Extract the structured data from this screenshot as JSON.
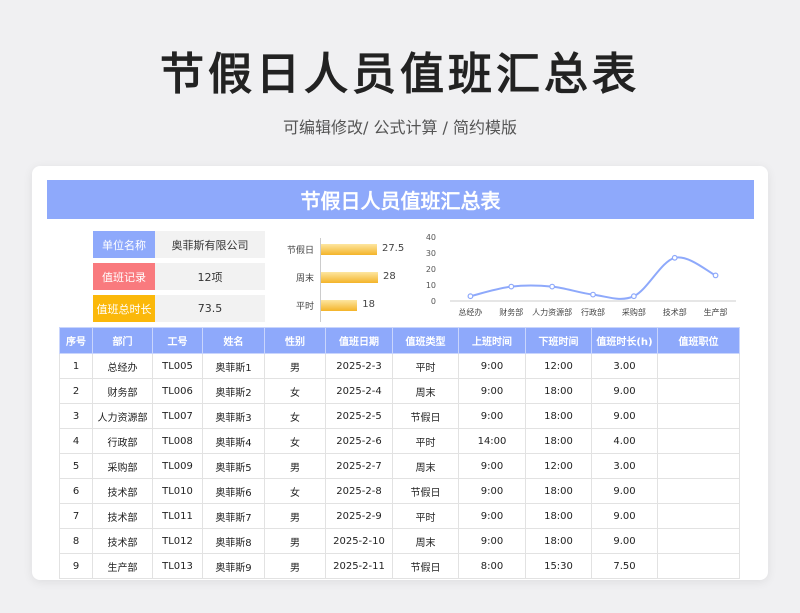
{
  "page": {
    "title": "节假日人员值班汇总表",
    "subtitle": "可编辑修改/  公式计算  /  简约模版"
  },
  "sheet": {
    "banner": "节假日人员值班汇总表",
    "info": [
      {
        "label": "单位名称",
        "value": "奥菲斯有限公司",
        "color": "#8ea9fb"
      },
      {
        "label": "值班记录",
        "value": "12项",
        "color": "#f97a7e"
      },
      {
        "label": "值班总时长",
        "value": "73.5",
        "color": "#fbb80a"
      }
    ],
    "columns": [
      "序号",
      "部门",
      "工号",
      "姓名",
      "性别",
      "值班日期",
      "值班类型",
      "上班时间",
      "下班时间",
      "值班时长(h)",
      "值班职位"
    ],
    "rows": [
      [
        "1",
        "总经办",
        "TL005",
        "奥菲斯1",
        "男",
        "2025-2-3",
        "平时",
        "9:00",
        "12:00",
        "3.00",
        ""
      ],
      [
        "2",
        "财务部",
        "TL006",
        "奥菲斯2",
        "女",
        "2025-2-4",
        "周末",
        "9:00",
        "18:00",
        "9.00",
        ""
      ],
      [
        "3",
        "人力资源部",
        "TL007",
        "奥菲斯3",
        "女",
        "2025-2-5",
        "节假日",
        "9:00",
        "18:00",
        "9.00",
        ""
      ],
      [
        "4",
        "行政部",
        "TL008",
        "奥菲斯4",
        "女",
        "2025-2-6",
        "平时",
        "14:00",
        "18:00",
        "4.00",
        ""
      ],
      [
        "5",
        "采购部",
        "TL009",
        "奥菲斯5",
        "男",
        "2025-2-7",
        "周末",
        "9:00",
        "12:00",
        "3.00",
        ""
      ],
      [
        "6",
        "技术部",
        "TL010",
        "奥菲斯6",
        "女",
        "2025-2-8",
        "节假日",
        "9:00",
        "18:00",
        "9.00",
        ""
      ],
      [
        "7",
        "技术部",
        "TL011",
        "奥菲斯7",
        "男",
        "2025-2-9",
        "平时",
        "9:00",
        "18:00",
        "9.00",
        ""
      ],
      [
        "8",
        "技术部",
        "TL012",
        "奥菲斯8",
        "男",
        "2025-2-10",
        "周末",
        "9:00",
        "18:00",
        "9.00",
        ""
      ],
      [
        "9",
        "生产部",
        "TL013",
        "奥菲斯9",
        "男",
        "2025-2-11",
        "节假日",
        "8:00",
        "15:30",
        "7.50",
        ""
      ]
    ]
  },
  "chart_data": [
    {
      "type": "bar",
      "orientation": "horizontal",
      "categories": [
        "节假日",
        "周末",
        "平时"
      ],
      "values": [
        27.5,
        28,
        18
      ],
      "bar_color": "#f4b429"
    },
    {
      "type": "line",
      "smooth": true,
      "categories": [
        "总经办",
        "财务部",
        "人力资源部",
        "行政部",
        "采购部",
        "技术部",
        "生产部"
      ],
      "values": [
        3,
        9,
        9,
        4,
        3,
        27,
        16
      ],
      "ylim": [
        0,
        40
      ],
      "yticks": [
        0,
        10,
        20,
        30,
        40
      ],
      "line_color": "#8ea9fb"
    }
  ]
}
